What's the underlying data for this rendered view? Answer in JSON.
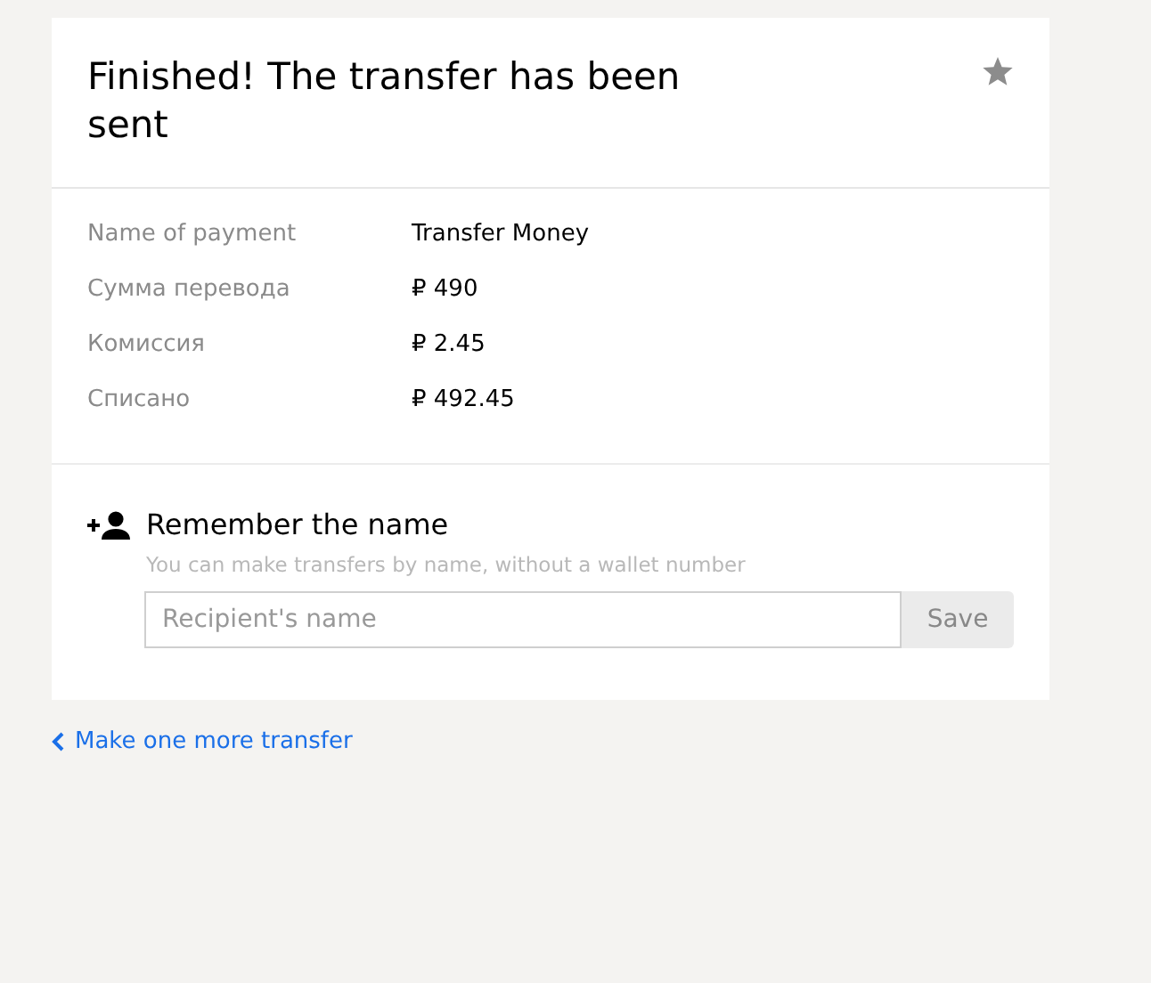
{
  "title": "Finished! The transfer has been sent",
  "details": [
    {
      "label": "Name of payment",
      "value": "Transfer Money"
    },
    {
      "label": "Сумма перевода",
      "value": "₽ 490"
    },
    {
      "label": "Комиссия",
      "value": "₽ 2.45"
    },
    {
      "label": "Списано",
      "value": "₽ 492.45"
    }
  ],
  "remember": {
    "heading": "Remember the name",
    "hint": "You can make transfers by name, without a wallet number",
    "placeholder": "Recipient's name",
    "button": "Save"
  },
  "back_link": "Make one more transfer"
}
